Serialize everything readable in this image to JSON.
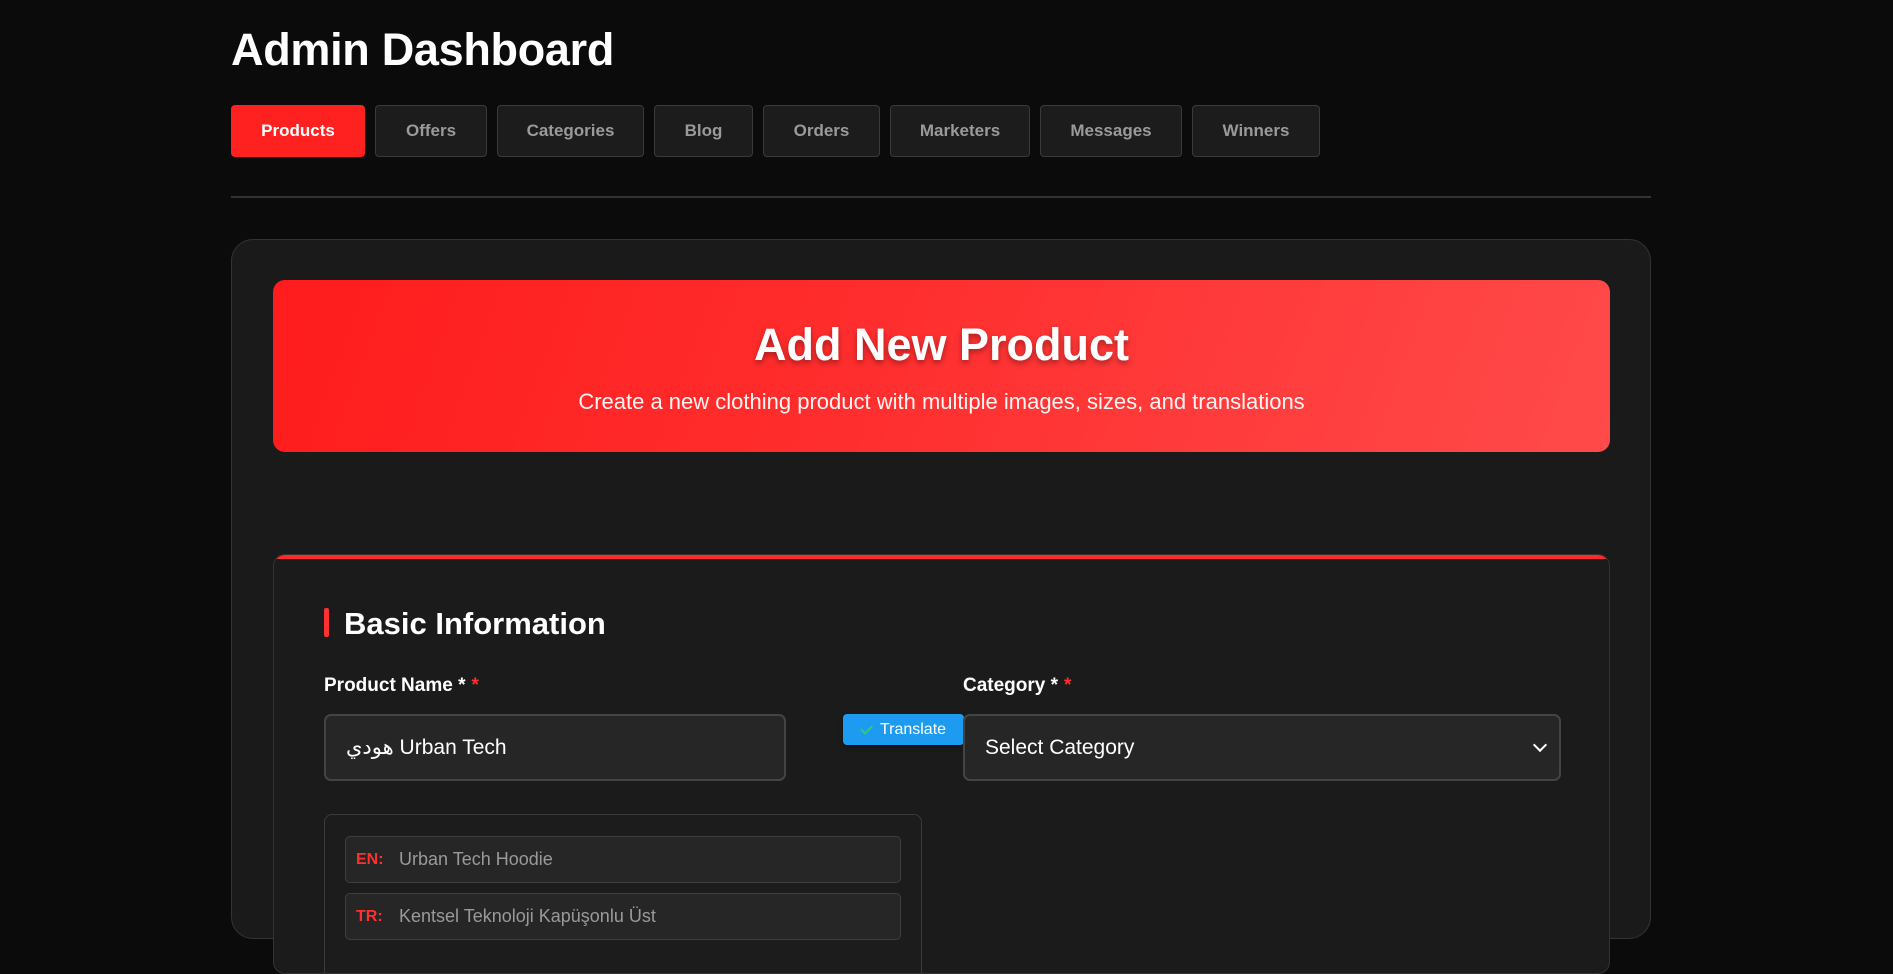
{
  "header": {
    "title": "Admin Dashboard"
  },
  "tabs": [
    {
      "label": "Products",
      "active": true
    },
    {
      "label": "Offers",
      "active": false
    },
    {
      "label": "Categories",
      "active": false
    },
    {
      "label": "Blog",
      "active": false
    },
    {
      "label": "Orders",
      "active": false
    },
    {
      "label": "Marketers",
      "active": false
    },
    {
      "label": "Messages",
      "active": false
    },
    {
      "label": "Winners",
      "active": false
    }
  ],
  "hero": {
    "title": "Add New Product",
    "subtitle": "Create a new clothing product with multiple images, sizes, and translations"
  },
  "basic_info": {
    "title": "Basic Information",
    "product_name_label": "Product Name *",
    "required_mark": "*",
    "product_name_value": "هودي Urban Tech",
    "translate_label": "Translate",
    "category_label": "Category *",
    "category_value": "Select Category",
    "translations": [
      {
        "code": "EN:",
        "text": "Urban Tech Hoodie"
      },
      {
        "code": "TR:",
        "text": "Kentsel Teknoloji Kapüşonlu Üst"
      }
    ]
  },
  "colors": {
    "accent": "#ff2020",
    "translate": "#1d9bf0",
    "background": "#0b0b0b"
  }
}
